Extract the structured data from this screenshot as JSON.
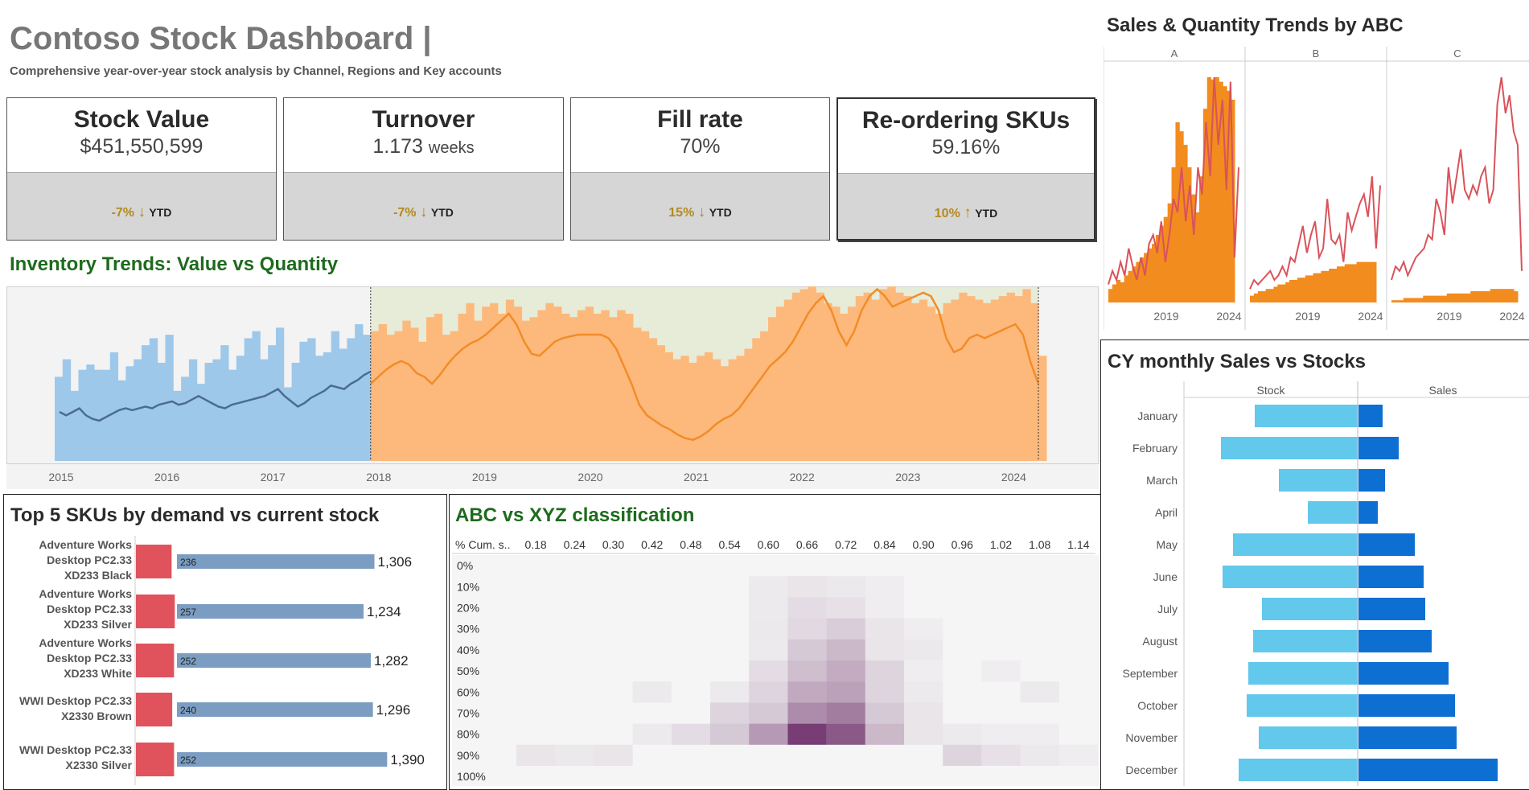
{
  "dashboard": {
    "title": "Contoso Stock Dashboard |",
    "subtitle": "Comprehensive year-over-year stock analysis by Channel, Regions and Key accounts"
  },
  "kpis": [
    {
      "label": "Stock Value",
      "value": "$451,550,599",
      "unit": "",
      "change": "-7%",
      "direction": "down",
      "period": "YTD"
    },
    {
      "label": "Turnover",
      "value": "1.173",
      "unit": "weeks",
      "change": "-7%",
      "direction": "down",
      "period": "YTD"
    },
    {
      "label": "Fill rate",
      "value": "70%",
      "unit": "",
      "change": "15%",
      "direction": "down",
      "period": "YTD"
    },
    {
      "label": "Re-ordering SKUs",
      "value": "59.16%",
      "unit": "",
      "change": "10%",
      "direction": "up",
      "period": "YTD",
      "selected": true
    }
  ],
  "icons": {
    "down": "arrow-down-icon",
    "up": "arrow-up-icon"
  },
  "colors": {
    "title_green": "#1d6b1d",
    "past_bar": "#9ec8ea",
    "past_line": "#4a6d8e",
    "future_bar": "#fdb97b",
    "future_line": "#f28c28",
    "highlight": "#e7ecd9",
    "abc_bar": "#f28c1e",
    "abc_line": "#d9535b",
    "stock_bar": "#62c8ec",
    "sales_bar": "#0d6fd1",
    "demand_bar": "#e0535c",
    "stock_sku_bar": "#7b9dc2",
    "heat": "#6b2d68",
    "kpi_change": "#b38a1e"
  },
  "sections": {
    "inventory_trends": "Inventory Trends: Value vs Quantity",
    "top5": "Top 5 SKUs by demand vs current stock",
    "abcxyz": "ABC vs XYZ classification",
    "abc_trends": "Sales & Quantity Trends by ABC",
    "monthly": "CY monthly Sales vs Stocks"
  },
  "chart_data": [
    {
      "id": "inventory_trends",
      "type": "bar",
      "title": "Inventory Trends: Value vs Quantity",
      "x_ticks": [
        "2015",
        "2016",
        "2017",
        "2018",
        "2019",
        "2020",
        "2021",
        "2022",
        "2023",
        "2024"
      ],
      "highlight_range": [
        "2018",
        "2024"
      ],
      "series": [
        {
          "name": "",
          "kind": "bar",
          "segment": "before 2018",
          "values": [
            48,
            58,
            40,
            52,
            55,
            52,
            52,
            62,
            46,
            54,
            58,
            66,
            70,
            56,
            72,
            40,
            48,
            58,
            44,
            56,
            58,
            66,
            52,
            60,
            70,
            74,
            58,
            66,
            76,
            42,
            56,
            68,
            70,
            60,
            62,
            74,
            64,
            70,
            78,
            72
          ]
        },
        {
          "name": "",
          "kind": "line",
          "segment": "before 2018",
          "values": [
            28,
            26,
            28,
            30,
            26,
            24,
            23,
            25,
            27,
            29,
            30,
            29,
            30,
            31,
            30,
            32,
            33,
            34,
            32,
            33,
            35,
            37,
            35,
            33,
            31,
            30,
            32,
            33,
            34,
            35,
            36,
            37,
            39,
            41,
            37,
            34,
            31,
            33,
            36,
            38,
            40,
            43,
            42,
            41,
            44,
            46,
            49,
            51
          ]
        },
        {
          "name": "",
          "kind": "bar",
          "segment": "2018 on",
          "values": [
            74,
            78,
            72,
            74,
            80,
            76,
            68,
            82,
            84,
            72,
            74,
            84,
            90,
            80,
            88,
            90,
            84,
            92,
            88,
            80,
            82,
            86,
            90,
            88,
            84,
            82,
            86,
            88,
            84,
            86,
            82,
            86,
            84,
            76,
            74,
            70,
            66,
            62,
            58,
            60,
            56,
            60,
            62,
            58,
            54,
            58,
            60,
            64,
            70,
            74,
            82,
            88,
            92,
            96,
            98,
            100,
            96,
            90,
            88,
            84,
            88,
            94,
            96,
            92,
            98,
            100,
            96,
            94,
            90,
            92,
            88,
            84,
            90,
            92,
            96,
            94,
            92,
            90,
            92,
            94,
            96,
            94,
            98,
            90,
            60
          ]
        },
        {
          "name": "",
          "kind": "line",
          "segment": "2018 on",
          "values": [
            44,
            48,
            52,
            55,
            57,
            55,
            50,
            48,
            44,
            49,
            55,
            60,
            64,
            67,
            69,
            72,
            76,
            80,
            84,
            78,
            68,
            61,
            60,
            64,
            68,
            70,
            71,
            72,
            72,
            72,
            72,
            70,
            64,
            54,
            44,
            32,
            26,
            23,
            20,
            18,
            15,
            13,
            12,
            14,
            17,
            21,
            24,
            26,
            30,
            36,
            42,
            48,
            54,
            58,
            62,
            68,
            76,
            84,
            90,
            94,
            86,
            74,
            66,
            74,
            86,
            94,
            98,
            94,
            88,
            90,
            92,
            94,
            96,
            94,
            86,
            70,
            62,
            64,
            70,
            72,
            70,
            72,
            74,
            76,
            78,
            72,
            56,
            44
          ]
        }
      ]
    },
    {
      "id": "top5",
      "type": "bar",
      "title": "Top 5 SKUs by demand vs current stock",
      "categories": [
        "Adventure Works Desktop PC2.33 XD233 Black",
        "Adventure Works Desktop PC2.33 XD233 Silver",
        "Adventure Works Desktop PC2.33 XD233 White",
        "WWI Desktop PC2.33 X2330 Brown",
        "WWI Desktop PC2.33 X2330 Silver"
      ],
      "category_lines": [
        [
          "Adventure Works",
          "Desktop PC2.33",
          "XD233 Black"
        ],
        [
          "Adventure Works",
          "Desktop PC2.33",
          "XD233 Silver"
        ],
        [
          "Adventure Works",
          "Desktop PC2.33",
          "XD233 White"
        ],
        [
          "WWI Desktop PC2.33",
          "X2330 Brown"
        ],
        [
          "WWI Desktop PC2.33",
          "X2330 Silver"
        ]
      ],
      "series": [
        {
          "name": "",
          "values": [
            236,
            257,
            252,
            240,
            252
          ]
        },
        {
          "name": "",
          "values": [
            1306,
            1234,
            1282,
            1296,
            1390
          ]
        }
      ],
      "value_labels": [
        "1,306",
        "1,234",
        "1,282",
        "1,296",
        "1,390"
      ]
    },
    {
      "id": "abcxyz",
      "type": "heatmap",
      "title": "ABC vs XYZ classification",
      "corner_label": "% Cum. s..",
      "x": [
        "0.18",
        "0.24",
        "0.30",
        "0.42",
        "0.48",
        "0.54",
        "0.60",
        "0.66",
        "0.72",
        "0.84",
        "0.90",
        "0.96",
        "1.02",
        "1.08",
        "1.14"
      ],
      "y": [
        "0%",
        "10%",
        "20%",
        "30%",
        "40%",
        "50%",
        "60%",
        "70%",
        "80%",
        "90%",
        "100%"
      ],
      "z": [
        [
          0,
          0,
          0,
          0,
          0,
          0,
          0,
          0,
          0,
          0,
          0,
          0,
          0,
          0,
          0
        ],
        [
          0,
          0,
          0,
          0,
          0,
          0,
          0.05,
          0.08,
          0.06,
          0.04,
          0,
          0,
          0,
          0,
          0
        ],
        [
          0,
          0,
          0,
          0,
          0,
          0,
          0.05,
          0.12,
          0.1,
          0.04,
          0,
          0,
          0,
          0,
          0
        ],
        [
          0,
          0,
          0,
          0,
          0,
          0,
          0.06,
          0.14,
          0.2,
          0.08,
          0.04,
          0,
          0,
          0,
          0
        ],
        [
          0,
          0,
          0,
          0,
          0,
          0,
          0.05,
          0.22,
          0.3,
          0.08,
          0.06,
          0,
          0,
          0,
          0
        ],
        [
          0,
          0,
          0,
          0,
          0,
          0,
          0.12,
          0.28,
          0.36,
          0.16,
          0.04,
          0,
          0.04,
          0,
          0
        ],
        [
          0,
          0,
          0,
          0.05,
          0,
          0.05,
          0.16,
          0.38,
          0.42,
          0.16,
          0.05,
          0,
          0,
          0.05,
          0
        ],
        [
          0,
          0,
          0,
          0,
          0,
          0.16,
          0.22,
          0.52,
          0.6,
          0.22,
          0.08,
          0,
          0,
          0,
          0
        ],
        [
          0,
          0,
          0,
          0.05,
          0.12,
          0.22,
          0.46,
          0.92,
          0.78,
          0.3,
          0.08,
          0.05,
          0.04,
          0.04,
          0
        ],
        [
          0.08,
          0.06,
          0.08,
          0,
          0,
          0,
          0,
          0,
          0,
          0,
          0,
          0.16,
          0.1,
          0.06,
          0.04
        ],
        [
          0,
          0,
          0,
          0,
          0,
          0,
          0,
          0,
          0,
          0,
          0,
          0,
          0,
          0,
          0
        ]
      ]
    },
    {
      "id": "abc_trends",
      "type": "bar",
      "title": "Sales & Quantity Trends by ABC",
      "panels": [
        "A",
        "B",
        "C"
      ],
      "x_ticks": [
        "2019",
        "2024"
      ],
      "bars": {
        "A": [
          6,
          8,
          10,
          9,
          12,
          14,
          16,
          18,
          20,
          22,
          24,
          26,
          30,
          34,
          38,
          44,
          60,
          80,
          76,
          70,
          60,
          48,
          40,
          56,
          86,
          100,
          99,
          100,
          98,
          96,
          94,
          90,
          0
        ],
        "B": [
          3,
          4,
          5,
          5,
          6,
          6,
          7,
          8,
          8,
          9,
          10,
          10,
          11,
          11,
          12,
          12,
          13,
          13,
          14,
          14,
          15,
          15,
          16,
          16,
          17,
          17,
          17,
          18,
          18,
          18,
          18,
          18,
          0
        ],
        "C": [
          1,
          1,
          1,
          2,
          2,
          2,
          2,
          2,
          3,
          3,
          3,
          3,
          3,
          3,
          4,
          4,
          4,
          4,
          4,
          4,
          5,
          5,
          5,
          5,
          5,
          6,
          6,
          6,
          6,
          6,
          6,
          5,
          0
        ]
      },
      "lines": {
        "A": [
          8,
          14,
          10,
          18,
          12,
          24,
          16,
          10,
          20,
          12,
          26,
          30,
          22,
          36,
          18,
          30,
          46,
          40,
          60,
          36,
          52,
          30,
          60,
          48,
          80,
          56,
          100,
          70,
          90,
          50,
          98,
          20,
          60
        ],
        "B": [
          6,
          10,
          8,
          10,
          12,
          14,
          10,
          12,
          16,
          12,
          20,
          18,
          26,
          34,
          22,
          30,
          36,
          20,
          24,
          46,
          28,
          26,
          30,
          18,
          40,
          32,
          38,
          44,
          48,
          38,
          56,
          24,
          52
        ],
        "C": [
          10,
          16,
          14,
          18,
          12,
          16,
          20,
          22,
          24,
          30,
          28,
          46,
          40,
          30,
          60,
          44,
          56,
          68,
          50,
          46,
          52,
          48,
          56,
          60,
          44,
          50,
          88,
          100,
          84,
          92,
          76,
          70,
          14
        ]
      }
    },
    {
      "id": "monthly",
      "type": "bar",
      "title": "CY monthly Sales vs Stocks",
      "categories": [
        "January",
        "February",
        "March",
        "April",
        "May",
        "June",
        "July",
        "August",
        "September",
        "October",
        "November",
        "December"
      ],
      "series": [
        {
          "name": "Stock",
          "values": [
            128,
            170,
            98,
            62,
            155,
            168,
            119,
            130,
            136,
            138,
            123,
            148
          ]
        },
        {
          "name": "Sales",
          "values": [
            30,
            50,
            33,
            24,
            70,
            81,
            83,
            91,
            112,
            120,
            122,
            173
          ]
        }
      ]
    }
  ]
}
